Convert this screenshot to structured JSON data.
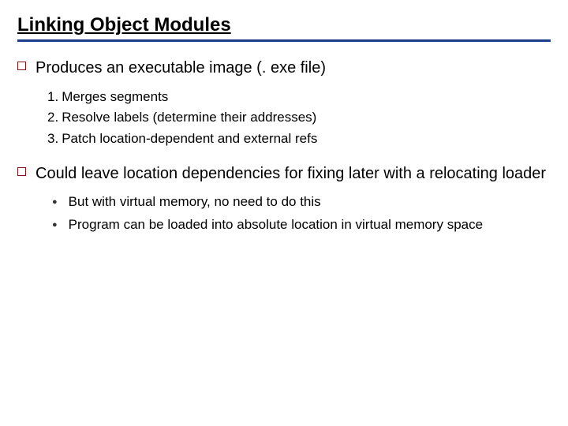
{
  "title": "Linking Object Modules",
  "points": [
    {
      "text": "Produces an executable image (. exe file)",
      "numbered": [
        "Merges segments",
        "Resolve labels (determine their addresses)",
        "Patch location-dependent and external refs"
      ]
    },
    {
      "text": "Could leave location dependencies for fixing later with a relocating loader",
      "sub": [
        "But with virtual memory, no need to do this",
        "Program can be loaded into absolute location in virtual memory space"
      ]
    }
  ]
}
